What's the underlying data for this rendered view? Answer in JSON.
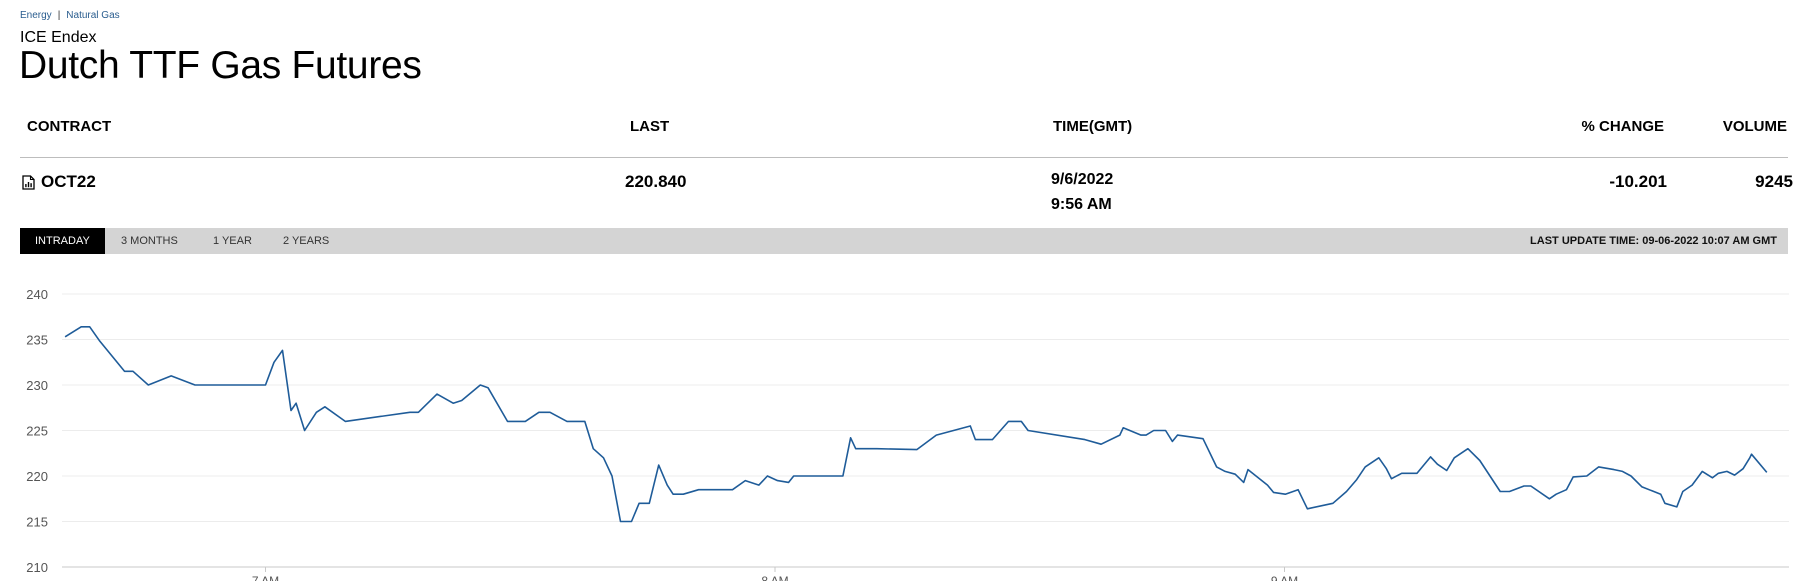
{
  "breadcrumb": {
    "items": [
      "Energy",
      "Natural Gas"
    ],
    "separator": "|"
  },
  "header": {
    "exchange": "ICE Endex",
    "title": "Dutch TTF Gas Futures"
  },
  "table": {
    "columns": {
      "contract": "CONTRACT",
      "last": "LAST",
      "time": "TIME(GMT)",
      "change": "% CHANGE",
      "volume": "VOLUME"
    },
    "row": {
      "contract": "OCT22",
      "last": "220.840",
      "date": "9/6/2022",
      "time": "9:56 AM",
      "change": "-10.201",
      "volume": "9245"
    }
  },
  "tabs": {
    "intraday": "INTRADAY",
    "three_months": "3 MONTHS",
    "one_year": "1 YEAR",
    "two_years": "2 YEARS",
    "active": "INTRADAY"
  },
  "last_update": "LAST UPDATE TIME: 09-06-2022 10:07 AM GMT",
  "chart_data": {
    "type": "line",
    "ylim": [
      210,
      240
    ],
    "yticks": [
      240,
      235,
      230,
      225,
      220,
      215,
      210
    ],
    "xtick_labels": [
      "7 AM",
      "8 AM",
      "9 AM"
    ],
    "xtick_minutes": [
      420,
      480,
      540
    ],
    "xlim_minutes": [
      395,
      600
    ],
    "line_color": "#1f5c99",
    "grid": true,
    "series": [
      {
        "minutes": [
          396.4,
          398.3,
          399.3,
          400.5,
          403.4,
          404.4,
          406.2,
          408.9,
          411.7,
          413.2,
          420.0,
          421.0,
          422.0,
          423.0,
          423.6,
          424.6,
          426.0,
          427.0,
          429.4,
          437.0,
          438.0,
          440.2,
          442.1,
          443.1,
          445.3,
          446.2,
          448.5,
          450.6,
          452.2,
          453.5,
          455.5,
          457.6,
          458.6,
          459.8,
          460.8,
          461.8,
          463.1,
          464.0,
          465.2,
          466.3,
          467.3,
          468.0,
          469.2,
          471.0,
          473.0,
          475.0,
          476.5,
          478.1,
          479.1,
          480.3,
          481.6,
          482.2,
          488.0,
          488.9,
          489.5,
          492.0,
          496.7,
          499.0,
          503.0,
          503.6,
          505.6,
          507.5,
          509.0,
          509.8,
          516.5,
          518.4,
          520.6,
          521.0,
          523.1,
          523.7,
          524.6,
          526.0,
          526.8,
          527.4,
          530.4,
          532.0,
          533.0,
          534.2,
          535.2,
          535.7,
          538.0,
          538.7,
          540.1,
          541.6,
          542.7,
          545.7,
          547.3,
          548.5,
          549.5,
          551.1,
          552.0,
          552.6,
          553.8,
          555.6,
          557.2,
          558.0,
          559.1,
          560.0,
          561.6,
          563.0,
          565.4,
          566.5,
          568.2,
          569.0,
          571.2,
          572.0,
          573.2,
          574.0,
          575.6,
          577.0,
          578.8,
          579.8,
          580.8,
          582.1,
          584.3,
          584.8,
          586.2,
          586.9,
          588.0,
          589.2,
          590.4,
          591.1,
          592.1,
          593.0,
          594.0,
          594.8,
          595.0,
          596.8
        ],
        "values": [
          235.3,
          236.4,
          236.4,
          234.8,
          231.5,
          231.5,
          230.0,
          231.0,
          230.0,
          230.0,
          230.0,
          232.5,
          233.8,
          227.2,
          228.0,
          225.0,
          227.0,
          227.6,
          226.0,
          227.0,
          227.0,
          229.0,
          228.0,
          228.3,
          230.0,
          229.7,
          226.0,
          226.0,
          227.0,
          227.0,
          226.0,
          226.0,
          223.0,
          222.0,
          220.0,
          215.0,
          215.0,
          217.0,
          217.0,
          221.2,
          219.0,
          218.0,
          218.0,
          218.5,
          218.5,
          218.5,
          219.5,
          219.0,
          220.0,
          219.5,
          219.3,
          220.0,
          220.0,
          224.2,
          223.0,
          223.0,
          222.9,
          224.5,
          225.5,
          224.0,
          224.0,
          226.0,
          226.0,
          225.0,
          224.0,
          223.5,
          224.5,
          225.3,
          224.5,
          224.5,
          225.0,
          225.0,
          223.8,
          224.5,
          224.1,
          221.0,
          220.5,
          220.2,
          219.3,
          220.7,
          219.0,
          218.2,
          218.0,
          218.5,
          216.4,
          217.0,
          218.3,
          219.6,
          221.0,
          222.0,
          220.8,
          219.7,
          220.3,
          220.3,
          222.1,
          221.3,
          220.6,
          222.0,
          223.0,
          221.7,
          218.3,
          218.3,
          218.9,
          218.9,
          217.5,
          218.0,
          218.5,
          219.9,
          220.0,
          221.0,
          220.7,
          220.5,
          220.0,
          218.8,
          218.0,
          217.0,
          216.6,
          218.3,
          219.0,
          220.5,
          219.8,
          220.3,
          220.5,
          220.1,
          220.8,
          222.0,
          222.4,
          220.4
        ]
      }
    ]
  }
}
